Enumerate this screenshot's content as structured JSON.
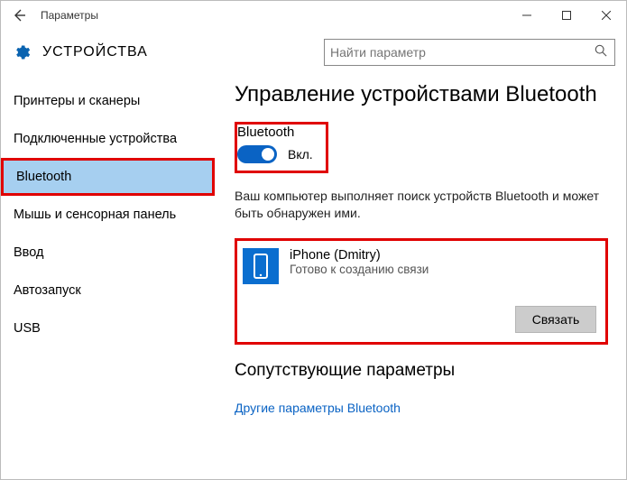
{
  "titlebar": {
    "title": "Параметры"
  },
  "header": {
    "category": "УСТРОЙСТВА",
    "search_placeholder": "Найти параметр"
  },
  "sidebar": {
    "items": [
      {
        "label": "Принтеры и сканеры"
      },
      {
        "label": "Подключенные устройства"
      },
      {
        "label": "Bluetooth"
      },
      {
        "label": "Мышь и сенсорная панель"
      },
      {
        "label": "Ввод"
      },
      {
        "label": "Автозапуск"
      },
      {
        "label": "USB"
      }
    ],
    "selected_index": 2
  },
  "main": {
    "title": "Управление устройствами Bluetooth",
    "bluetooth": {
      "label": "Bluetooth",
      "state": "Вкл.",
      "enabled": true
    },
    "description": "Ваш компьютер выполняет поиск устройств Bluetooth и может быть обнаружен ими.",
    "device": {
      "name": "iPhone (Dmitry)",
      "status": "Готово к созданию связи",
      "pair_label": "Связать"
    },
    "related": {
      "heading": "Сопутствующие параметры",
      "link": "Другие параметры Bluetooth"
    }
  }
}
